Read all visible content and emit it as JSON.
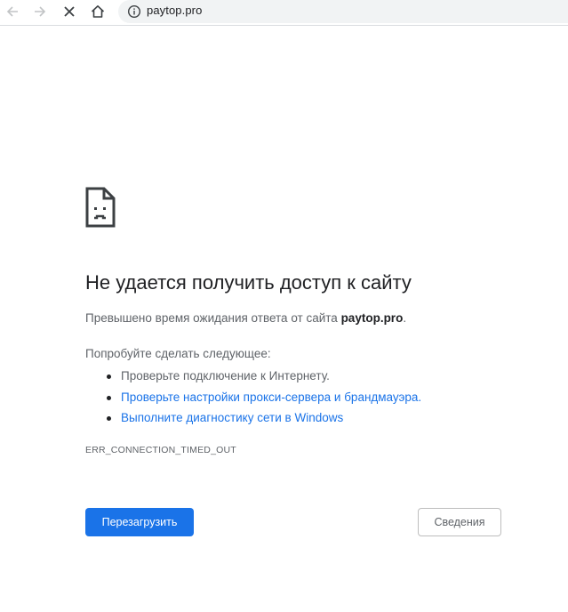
{
  "browser": {
    "url": "paytop.pro",
    "icons": {
      "back": "arrow-left-icon",
      "forward": "arrow-right-icon",
      "stop": "close-icon",
      "home": "home-icon",
      "site_info": "info-icon"
    }
  },
  "error_page": {
    "icon": "sad-document-icon",
    "title": "Не удается получить доступ к сайту",
    "description_prefix": "Превышено время ожидания ответа от сайта ",
    "description_host": "paytop.pro",
    "description_suffix": ".",
    "try_label": "Попробуйте сделать следующее:",
    "suggestions": [
      {
        "text": "Проверьте подключение к Интернету.",
        "link": false
      },
      {
        "text": "Проверьте настройки прокси-сервера и брандмауэра.",
        "link": true
      },
      {
        "text": "Выполните диагностику сети в Windows",
        "link": true
      }
    ],
    "error_code": "ERR_CONNECTION_TIMED_OUT",
    "reload_label": "Перезагрузить",
    "details_label": "Сведения"
  },
  "colors": {
    "accent": "#1a73e8",
    "text_primary": "#202124",
    "text_secondary": "#5f6368",
    "omnibox_bg": "#f1f3f4"
  }
}
